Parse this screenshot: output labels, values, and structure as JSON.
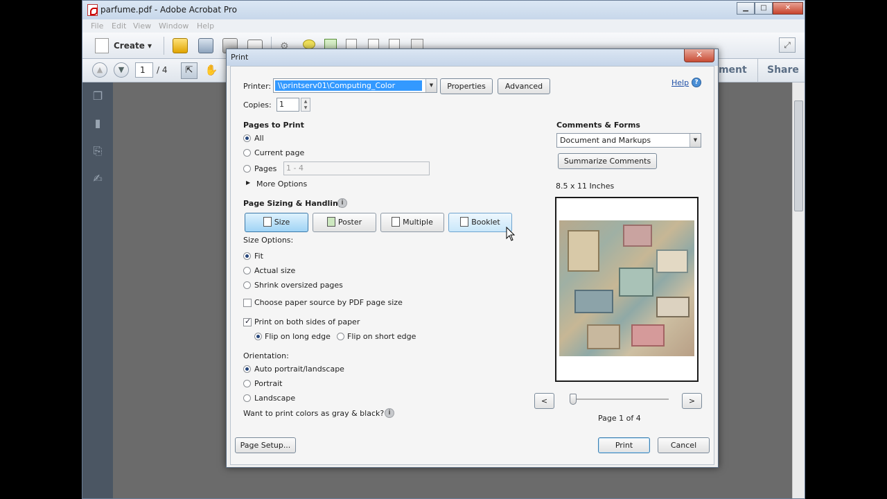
{
  "app": {
    "window_title": "parfume.pdf - Adobe Acrobat Pro",
    "menu": [
      "File",
      "Edit",
      "View",
      "Window",
      "Help"
    ],
    "create_label": "Create",
    "page_current": "1",
    "page_total": "/ 4",
    "comment_label": "nment",
    "share_label": "Share"
  },
  "print": {
    "title": "Print",
    "help_label": "Help",
    "printer_label": "Printer:",
    "printer_value": "\\\\printserv01\\Computing_Color",
    "properties_label": "Properties",
    "advanced_label": "Advanced",
    "copies_label": "Copies:",
    "copies_value": "1",
    "pages_to_print": {
      "heading": "Pages to Print",
      "options": [
        "All",
        "Current page",
        "Pages"
      ],
      "selected": "All",
      "pages_range_placeholder": "1 - 4",
      "more_options": "More Options"
    },
    "sizing": {
      "heading": "Page Sizing & Handling",
      "modes": [
        "Size",
        "Poster",
        "Multiple",
        "Booklet"
      ],
      "selected_mode": "Size",
      "size_options_label": "Size Options:",
      "size_options": [
        "Fit",
        "Actual size",
        "Shrink oversized pages"
      ],
      "selected_size_option": "Fit",
      "paper_source_label": "Choose paper source by PDF page size",
      "paper_source_checked": false,
      "duplex_label": "Print on both sides of paper",
      "duplex_checked": true,
      "flip_options": [
        "Flip on long edge",
        "Flip on short edge"
      ],
      "selected_flip": "Flip on long edge"
    },
    "orientation": {
      "label": "Orientation:",
      "options": [
        "Auto portrait/landscape",
        "Portrait",
        "Landscape"
      ],
      "selected": "Auto portrait/landscape"
    },
    "gray_question": "Want to print colors as gray & black?",
    "comments_forms": {
      "heading": "Comments & Forms",
      "value": "Document and Markups",
      "summarize_label": "Summarize Comments"
    },
    "preview": {
      "paper_size": "8.5 x 11 Inches",
      "page_indicator": "Page 1 of 4",
      "prev_label": "<",
      "next_label": ">"
    },
    "page_setup_label": "Page Setup...",
    "print_label": "Print",
    "cancel_label": "Cancel"
  },
  "colors": {
    "selection_blue": "#3399ff",
    "dialog_bg": "#f5f5f5",
    "doc_area": "#6b6b6b"
  }
}
